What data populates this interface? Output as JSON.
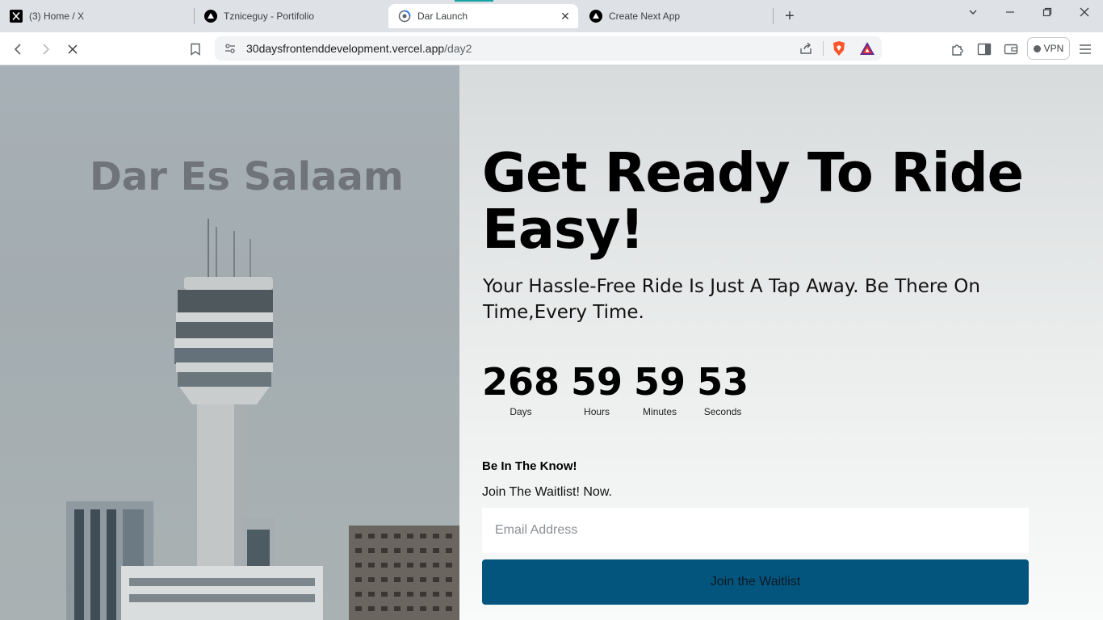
{
  "tabs": [
    {
      "title": "(3) Home / X",
      "icon": "x-logo-icon"
    },
    {
      "title": "Tzniceguy - Portifolio",
      "icon": "vercel-triangle-icon"
    },
    {
      "title": "Dar Launch",
      "icon": "loading-globe-icon",
      "active": true
    },
    {
      "title": "Create Next App",
      "icon": "vercel-triangle-icon"
    }
  ],
  "toolbar": {
    "url_host": "30daysfrontenddevelopment.vercel.app",
    "url_path": "/day2",
    "vpn_label": "VPN"
  },
  "hero": {
    "city": "Dar Es Salaam"
  },
  "main": {
    "headline": "Get Ready To Ride Easy!",
    "subline": "Your Hassle-Free Ride Is Just A Tap Away. Be There On Time,Every Time.",
    "countdown": [
      {
        "value": "268",
        "label": "Days"
      },
      {
        "value": "59",
        "label": "Hours"
      },
      {
        "value": "59",
        "label": "Minutes"
      },
      {
        "value": "53",
        "label": "Seconds"
      }
    ],
    "know_title": "Be In The Know!",
    "waitlist_text": "Join The Waitlist! Now.",
    "email_placeholder": "Email Address",
    "join_label": "Join the Waitlist"
  },
  "colors": {
    "button": "#03557e",
    "tabstrip": "#dee1e6"
  }
}
